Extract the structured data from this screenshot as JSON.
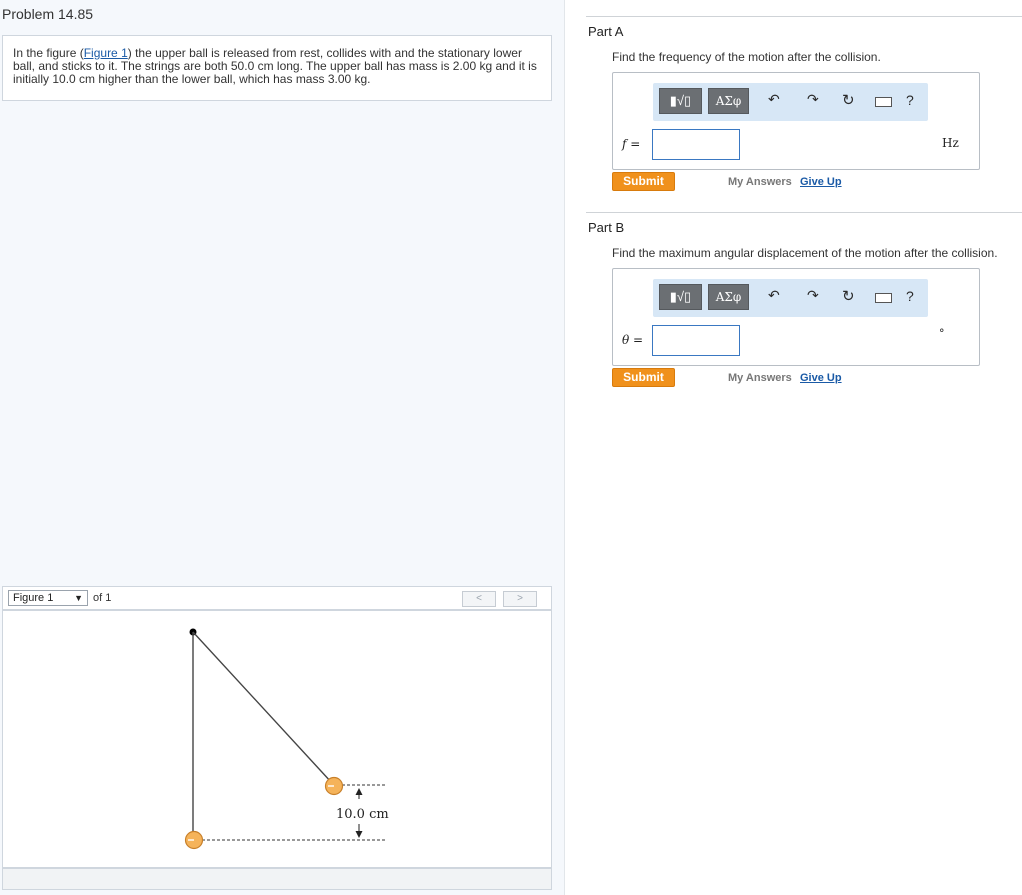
{
  "problem": {
    "title": "Problem 14.85",
    "text_before_link": "In the figure (",
    "link": "Figure 1",
    "text_after_link": ") the upper ball is released from rest, collides with and the stationary lower ball, and sticks to it. The strings are both 50.0 cm long. The upper ball has mass is 2.00 kg and it is initially 10.0 cm higher than the lower ball, which has mass 3.00 kg."
  },
  "figure_nav": {
    "selected": "Figure 1",
    "of_label": "of 1",
    "prev": "<",
    "next": ">"
  },
  "figure": {
    "height_label": "10.0 cm",
    "ball_color": "#f5b35a"
  },
  "parts": [
    {
      "label": "Part A",
      "question": "Find the frequency of the motion after the collision.",
      "variable": "f =",
      "unit": "Hz",
      "input_value": "",
      "submit": "Submit",
      "my_answers": "My Answers",
      "give_up": "Give Up"
    },
    {
      "label": "Part B",
      "question": "Find the maximum angular displacement of the motion after the collision.",
      "variable": "θ =",
      "unit": "°",
      "input_value": "",
      "submit": "Submit",
      "my_answers": "My Answers",
      "give_up": "Give Up"
    }
  ],
  "toolbar": {
    "template_btn": "▮√▯",
    "greek_btn": "ΑΣφ",
    "undo_icon": "undo-icon",
    "redo_icon": "redo-icon",
    "reset_icon": "reset-icon",
    "keyboard_icon": "keyboard-icon",
    "help": "?"
  },
  "colors": {
    "submit": "#f0911c",
    "toolbar_bg": "#d7e7f6",
    "link": "#1a5aa6"
  }
}
